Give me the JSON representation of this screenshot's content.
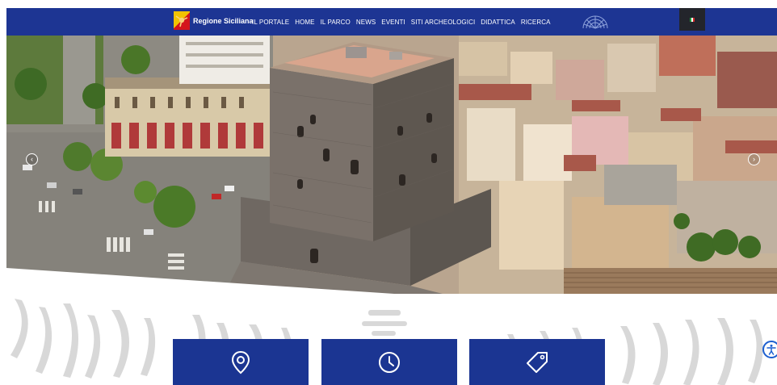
{
  "header": {
    "brand_name": "Regione Siciliana",
    "nav": [
      "IL PORTALE",
      "HOME",
      "IL PARCO",
      "NEWS",
      "EVENTI",
      "SITI ARCHEOLOGICI",
      "DIDATTICA",
      "RICERCA"
    ],
    "language_flag": "it-flag-icon"
  },
  "hero": {
    "prev_icon": "chevron-left-icon",
    "next_icon": "chevron-right-icon"
  },
  "cards": [
    {
      "icon": "location-pin-icon"
    },
    {
      "icon": "clock-icon"
    },
    {
      "icon": "tag-icon"
    }
  ],
  "accessibility_icon": "accessibility-icon",
  "colors": {
    "header_bg": "#1d3593",
    "card_bg": "#1b3592",
    "accent_blue": "#1d5fd0",
    "lang_box_bg": "#23252b"
  }
}
